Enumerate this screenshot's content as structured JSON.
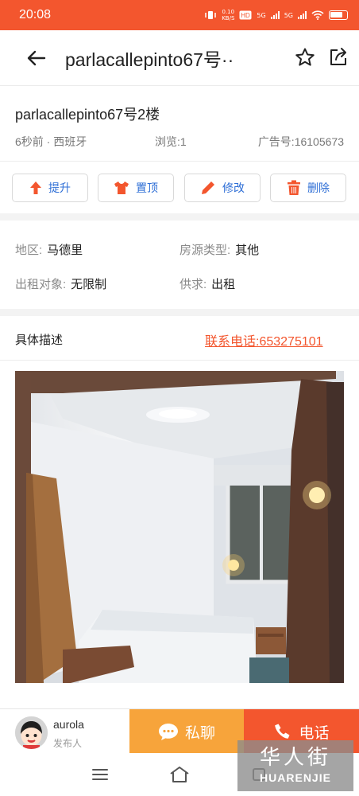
{
  "status_bar": {
    "time": "20:08",
    "net_speed": "0.10\nKB/S",
    "net_type_1": "5G",
    "net_type_2": "5G"
  },
  "nav": {
    "title": "parlacallepinto67号··"
  },
  "post": {
    "title": "parlacallepinto67号2楼",
    "posted": "6秒前 · 西班牙",
    "views": "浏览:1",
    "ad_number": "广告号:16105673"
  },
  "actions": [
    {
      "label": "提升",
      "icon": "arrow-up-icon"
    },
    {
      "label": "置顶",
      "icon": "shirt-icon"
    },
    {
      "label": "修改",
      "icon": "pencil-icon"
    },
    {
      "label": "删除",
      "icon": "trash-icon"
    }
  ],
  "details": {
    "region_label": "地区:",
    "region_value": "马德里",
    "type_label": "房源类型:",
    "type_value": "其他",
    "tenant_label": "出租对象:",
    "tenant_value": "无限制",
    "supply_label": "供求:",
    "supply_value": "出租"
  },
  "description": {
    "label": "具体描述",
    "phone": "联系电话:653275101"
  },
  "publisher": {
    "name": "aurola",
    "role": "发布人"
  },
  "bottom_actions": {
    "chat": "私聊",
    "call": "电话"
  },
  "watermark": {
    "cn": "华人街",
    "en": "HUARENJIE"
  },
  "colors": {
    "accent": "#f3562e",
    "chat": "#f7a43b",
    "button_text": "#2f6fd6"
  }
}
